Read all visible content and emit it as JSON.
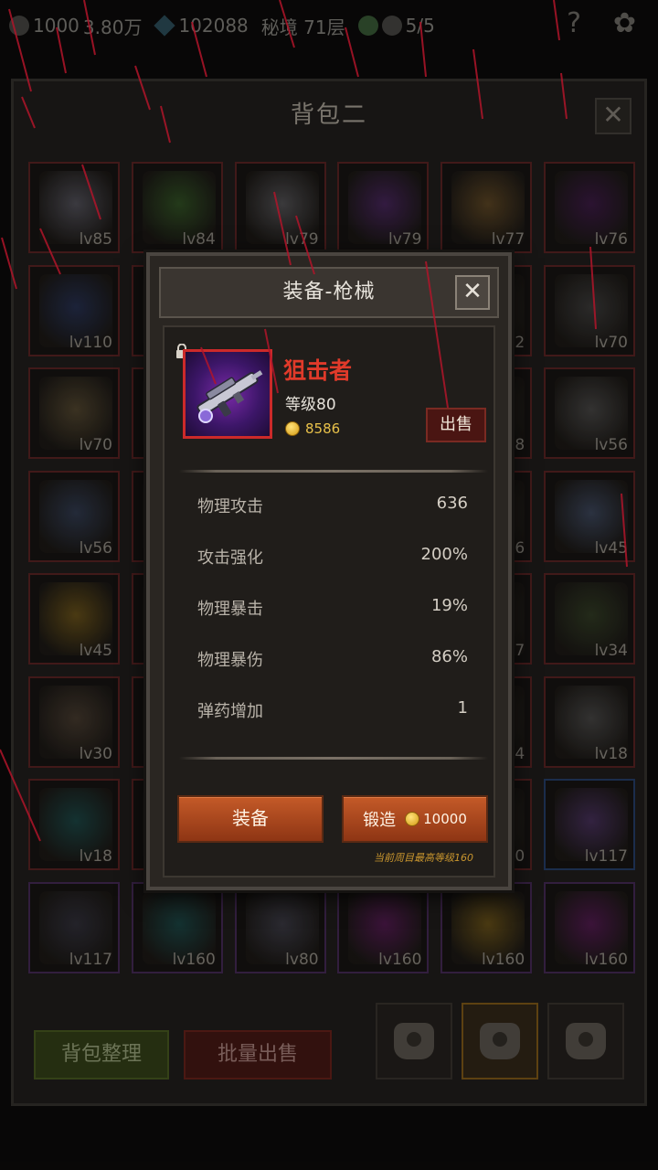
{
  "topbar": {
    "gold": "1000",
    "wood": "3.80万",
    "gems": "102088",
    "dungeon": "秘境 71层",
    "skull_count": "5/5",
    "help_glyph": "?",
    "settings_glyph": "✿"
  },
  "bag": {
    "title": "背包二",
    "close_glyph": "✕",
    "sort_label": "背包整理",
    "bulk_sell_label": "批量出售",
    "slots": [
      {
        "lv": "lv85",
        "color": "#6a6a78"
      },
      {
        "lv": "lv84",
        "color": "#3a6a2a"
      },
      {
        "lv": "lv79",
        "color": "#6a6a70"
      },
      {
        "lv": "lv79",
        "color": "#5a2a7a"
      },
      {
        "lv": "lv77",
        "color": "#7a5a2a"
      },
      {
        "lv": "lv76",
        "color": "#4a1a5a"
      },
      {
        "lv": "lv110",
        "color": "#2a3a6a"
      },
      {
        "lv": "",
        "color": "#3a3028"
      },
      {
        "lv": "",
        "color": "#3a3028"
      },
      {
        "lv": "",
        "color": "#3a3028"
      },
      {
        "lv": "2",
        "color": "#3a3028"
      },
      {
        "lv": "lv70",
        "color": "#4a4a4a"
      },
      {
        "lv": "lv70",
        "color": "#6a5a3a"
      },
      {
        "lv": "",
        "color": "#3a3028"
      },
      {
        "lv": "",
        "color": "#3a3028"
      },
      {
        "lv": "",
        "color": "#3a3028"
      },
      {
        "lv": "8",
        "color": "#3a3028"
      },
      {
        "lv": "lv56",
        "color": "#5a5a5a"
      },
      {
        "lv": "lv56",
        "color": "#3a4a6a"
      },
      {
        "lv": "",
        "color": "#3a3028"
      },
      {
        "lv": "",
        "color": "#3a3028"
      },
      {
        "lv": "",
        "color": "#3a3028"
      },
      {
        "lv": "6",
        "color": "#3a3028"
      },
      {
        "lv": "lv45",
        "color": "#4a5a7a"
      },
      {
        "lv": "lv45",
        "color": "#8a6a1a"
      },
      {
        "lv": "",
        "color": "#3a3028"
      },
      {
        "lv": "",
        "color": "#3a3028"
      },
      {
        "lv": "",
        "color": "#3a3028"
      },
      {
        "lv": "7",
        "color": "#3a3028"
      },
      {
        "lv": "lv34",
        "color": "#3a4a2a"
      },
      {
        "lv": "lv30",
        "color": "#5a4a3a"
      },
      {
        "lv": "",
        "color": "#3a3028"
      },
      {
        "lv": "",
        "color": "#3a3028"
      },
      {
        "lv": "",
        "color": "#3a3028"
      },
      {
        "lv": "4",
        "color": "#3a3028"
      },
      {
        "lv": "lv18",
        "color": "#5a5a5a"
      },
      {
        "lv": "lv18",
        "color": "#1a5a5a"
      },
      {
        "lv": "",
        "color": "#3a3028"
      },
      {
        "lv": "",
        "color": "#3a3028"
      },
      {
        "lv": "",
        "color": "#3a3028"
      },
      {
        "lv": "10",
        "color": "#3a3028"
      },
      {
        "lv": "lv117",
        "color": "#5a3a7a"
      },
      {
        "lv": "lv117",
        "color": "#3a3a4a"
      },
      {
        "lv": "lv160",
        "color": "#1a5a5a"
      },
      {
        "lv": "lv80",
        "color": "#4a4a5a"
      },
      {
        "lv": "lv160",
        "color": "#6a1a6a"
      },
      {
        "lv": "lv160",
        "color": "#8a6a1a"
      },
      {
        "lv": "lv160",
        "color": "#6a1a6a"
      }
    ]
  },
  "dialog": {
    "title": "装备-枪械",
    "close_glyph": "✕",
    "item": {
      "name": "狙击者",
      "level": "等级80",
      "price": "8586",
      "sell_label": "出售"
    },
    "stats": [
      {
        "key": "物理攻击",
        "value": "636"
      },
      {
        "key": "攻击强化",
        "value": "200%"
      },
      {
        "key": "物理暴击",
        "value": "19%"
      },
      {
        "key": "物理暴伤",
        "value": "86%"
      },
      {
        "key": "弹药增加",
        "value": "1"
      }
    ],
    "equip_label": "装备",
    "forge_label": "锻造",
    "forge_cost": "10000",
    "forge_note": "当前周目最高等级160"
  },
  "colors": {
    "item_name": "#e03a2a",
    "gold_text": "#e8c14a",
    "button_orange": "#b04a1e",
    "rare_border_red": "#cc2a2a"
  }
}
